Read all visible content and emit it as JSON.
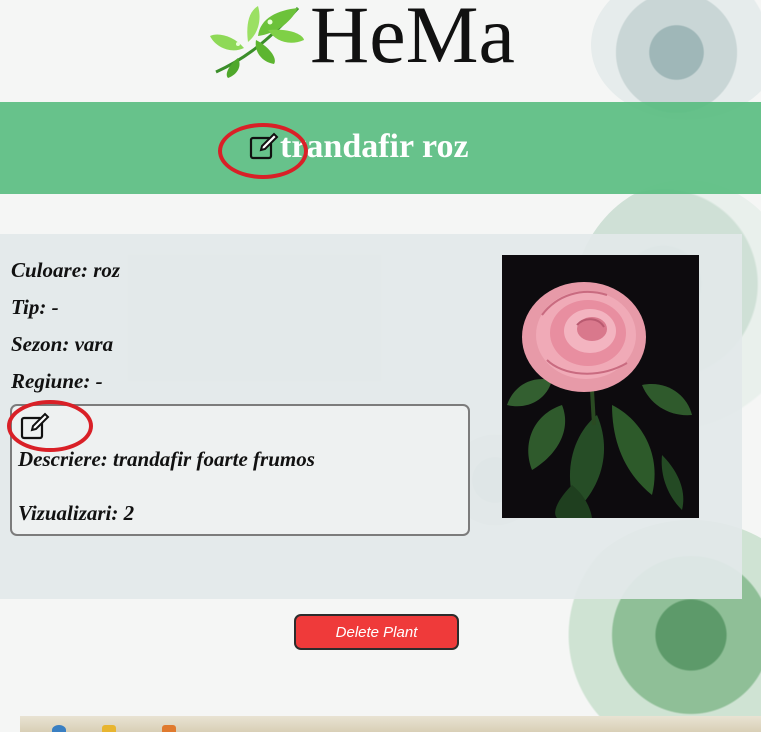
{
  "header": {
    "logo_text": "HeMa",
    "logo_icon": "leaf-icon"
  },
  "plant": {
    "title": "trandafir roz",
    "edit_title_icon": "edit-icon",
    "attributes": [
      {
        "label": "Culoare: roz"
      },
      {
        "label": "Tip: -"
      },
      {
        "label": "Sezon: vara"
      },
      {
        "label": "Regiune: -"
      }
    ],
    "edit_description_icon": "edit-icon",
    "description": "Descriere: trandafir foarte frumos",
    "views": "Vizualizari: 2",
    "image": "pink-rose-photo"
  },
  "actions": {
    "delete_label": "Delete Plant"
  },
  "colors": {
    "title_band": "#58bc80",
    "delete_button": "#ef3a3a",
    "annotation_ring": "#d92027"
  }
}
